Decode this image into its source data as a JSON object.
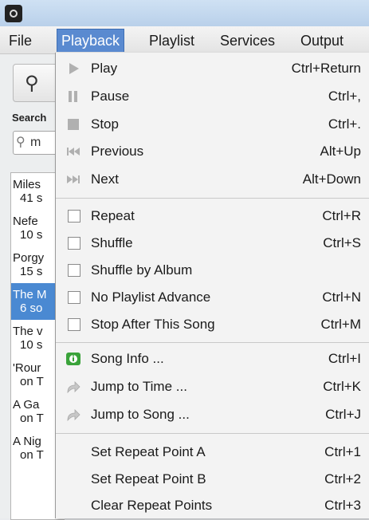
{
  "menubar": {
    "items": [
      {
        "label": "File"
      },
      {
        "label": "Playback"
      },
      {
        "label": "Playlist"
      },
      {
        "label": "Services"
      },
      {
        "label": "Output"
      }
    ]
  },
  "sidebar": {
    "search_heading": "Search",
    "search_value": "m",
    "albums": [
      {
        "title": "Miles",
        "count": "41 s"
      },
      {
        "title": "Nefe",
        "count": "10 s"
      },
      {
        "title": "Porgy",
        "count": "15 s"
      },
      {
        "title": "The M",
        "count": "6 so"
      },
      {
        "title": "The v",
        "count": "10 s"
      },
      {
        "title": "'Rour",
        "count": "on T"
      },
      {
        "title": "A Ga",
        "count": "on T"
      },
      {
        "title": "A Nig",
        "count": "on T"
      }
    ]
  },
  "playback_menu": {
    "items": [
      {
        "label": "Play",
        "shortcut": "Ctrl+Return",
        "icon": "play-icon"
      },
      {
        "label": "Pause",
        "shortcut": "Ctrl+,",
        "icon": "pause-icon"
      },
      {
        "label": "Stop",
        "shortcut": "Ctrl+.",
        "icon": "stop-icon"
      },
      {
        "label": "Previous",
        "shortcut": "Alt+Up",
        "icon": "previous-icon"
      },
      {
        "label": "Next",
        "shortcut": "Alt+Down",
        "icon": "next-icon"
      },
      {
        "label": "Repeat",
        "shortcut": "Ctrl+R",
        "checked": false
      },
      {
        "label": "Shuffle",
        "shortcut": "Ctrl+S",
        "checked": false
      },
      {
        "label": "Shuffle by Album",
        "shortcut": "",
        "checked": false
      },
      {
        "label": "No Playlist Advance",
        "shortcut": "Ctrl+N",
        "checked": false
      },
      {
        "label": "Stop After This Song",
        "shortcut": "Ctrl+M",
        "checked": false
      },
      {
        "label": "Song Info ...",
        "shortcut": "Ctrl+I",
        "icon": "info-icon"
      },
      {
        "label": "Jump to Time ...",
        "shortcut": "Ctrl+K",
        "icon": "jump-icon"
      },
      {
        "label": "Jump to Song ...",
        "shortcut": "Ctrl+J",
        "icon": "jump-icon"
      },
      {
        "label": "Set Repeat Point A",
        "shortcut": "Ctrl+1"
      },
      {
        "label": "Set Repeat Point B",
        "shortcut": "Ctrl+2"
      },
      {
        "label": "Clear Repeat Points",
        "shortcut": "Ctrl+3"
      }
    ]
  },
  "colors": {
    "accent": "#5a8ad0",
    "selection": "#4a89d2",
    "info_green": "#3aa33a"
  }
}
